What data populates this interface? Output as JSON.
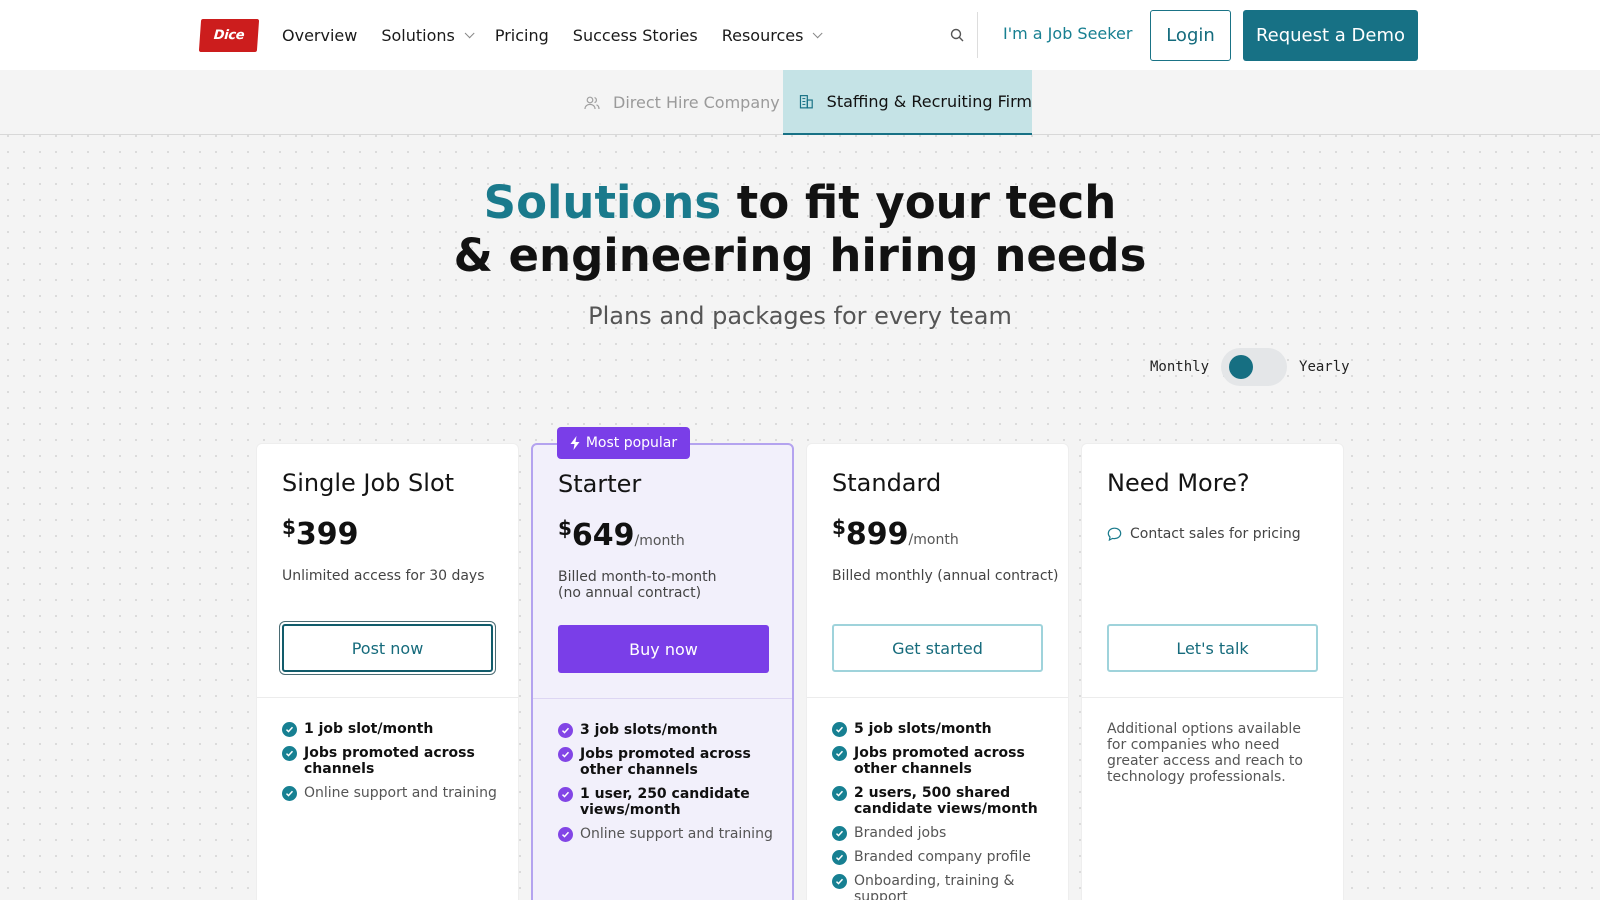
{
  "header": {
    "logo_text": "Dice",
    "nav": [
      {
        "label": "Overview",
        "has_dropdown": false
      },
      {
        "label": "Solutions",
        "has_dropdown": true
      },
      {
        "label": "Pricing",
        "has_dropdown": false
      },
      {
        "label": "Success Stories",
        "has_dropdown": false
      },
      {
        "label": "Resources",
        "has_dropdown": true
      }
    ],
    "search_icon": "search-icon",
    "job_seeker_label": "I'm a Job Seeker",
    "login_label": "Login",
    "demo_label": "Request a Demo"
  },
  "tabs": {
    "direct_hire": "Direct Hire Company",
    "staffing": "Staffing & Recruiting Firm",
    "active": "staffing"
  },
  "hero": {
    "title_accent": "Solutions",
    "title_rest_1": " to fit your tech",
    "title_line_2": "& engineering hiring needs",
    "subtitle": "Plans and packages for every team"
  },
  "billing": {
    "monthly_label": "Monthly",
    "yearly_label": "Yearly",
    "selected": "Monthly"
  },
  "colors": {
    "teal": "#177185",
    "purple": "#7a3ee8",
    "brand_red": "#cc1d1d"
  },
  "plans": [
    {
      "name": "Single Job Slot",
      "currency": "$",
      "price": "399",
      "period": "",
      "billing_note_1": "Unlimited access for 30 days",
      "billing_note_2": "",
      "cta": "Post now",
      "features": [
        {
          "text": "1 job slot/month",
          "bold": true
        },
        {
          "text": "Jobs promoted across channels",
          "bold": true
        },
        {
          "text": "Online support and training",
          "bold": false
        }
      ]
    },
    {
      "name": "Starter",
      "badge": "Most popular",
      "currency": "$",
      "price": "649",
      "period": "/month",
      "billing_note_1": "Billed month-to-month",
      "billing_note_2": "(no annual contract)",
      "cta": "Buy now",
      "features": [
        {
          "text": "3 job slots/month",
          "bold": true
        },
        {
          "text": "Jobs promoted across other channels",
          "bold": true
        },
        {
          "text": "1 user, 250 candidate views/month",
          "bold": true
        },
        {
          "text": "Online support and training",
          "bold": false
        }
      ]
    },
    {
      "name": "Standard",
      "currency": "$",
      "price": "899",
      "period": "/month",
      "billing_note_1": "Billed monthly (annual contract)",
      "billing_note_2": "",
      "cta": "Get started",
      "features": [
        {
          "text": "5 job slots/month",
          "bold": true
        },
        {
          "text": "Jobs promoted across other channels",
          "bold": true
        },
        {
          "text": "2 users, 500 shared candidate views/month",
          "bold": true
        },
        {
          "text": "Branded jobs",
          "bold": false
        },
        {
          "text": "Branded company profile",
          "bold": false
        },
        {
          "text": "Onboarding, training & support",
          "bold": false
        }
      ]
    },
    {
      "name": "Need More?",
      "contact": "Contact sales for pricing",
      "cta": "Let's talk",
      "note": "Additional options available for companies who need greater access and reach to technology professionals."
    }
  ]
}
